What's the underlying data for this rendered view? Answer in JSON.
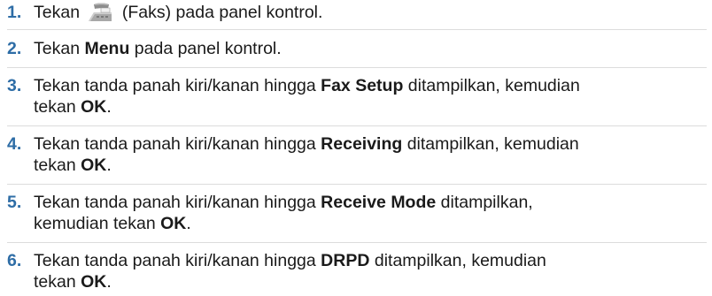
{
  "steps": [
    {
      "number": "1.",
      "pre": "Tekan",
      "icon": "fax-icon",
      "post": "(Faks) pada panel kontrol."
    },
    {
      "number": "2.",
      "pre": "Tekan ",
      "bold": "Menu",
      "post": " pada panel kontrol."
    },
    {
      "number": "3.",
      "pre": "Tekan tanda panah kiri/kanan hingga ",
      "bold": "Fax Setup",
      "mid": " ditampilkan, kemudian",
      "line2_pre": "tekan ",
      "line2_bold": "OK",
      "line2_post": "."
    },
    {
      "number": "4.",
      "pre": "Tekan tanda panah kiri/kanan hingga ",
      "bold": "Receiving",
      "mid": " ditampilkan, kemudian",
      "line2_pre": "tekan ",
      "line2_bold": "OK",
      "line2_post": "."
    },
    {
      "number": "5.",
      "pre": "Tekan tanda panah kiri/kanan hingga ",
      "bold": "Receive Mode",
      "mid": " ditampilkan,",
      "line2_pre": "kemudian tekan ",
      "line2_bold": "OK",
      "line2_post": "."
    },
    {
      "number": "6.",
      "pre": "Tekan tanda panah kiri/kanan hingga ",
      "bold": "DRPD",
      "mid": " ditampilkan, kemudian",
      "line2_pre": "tekan ",
      "line2_bold": "OK",
      "line2_post": "."
    }
  ],
  "colors": {
    "number": "#2e6da6",
    "text": "#1a1a1a",
    "divider": "#dcdcdc"
  }
}
